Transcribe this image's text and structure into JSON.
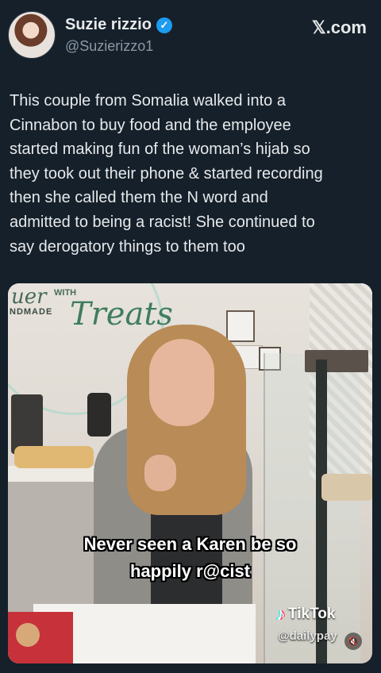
{
  "author": {
    "name": "Suzie rizzio",
    "handle": "@Suzierizzo1",
    "verified_icon": "verified-badge-icon"
  },
  "brand": "𝕏.com",
  "tweet": {
    "text": "This couple from Somalia walked into a\nCinnabon to buy food and the employee\nstarted making fun of the woman’s hijab so\nthey took out their phone & started recording\nthen she called them the N word and\nadmitted to being a racist! She continued to\nsay derogatory things to them too"
  },
  "media": {
    "sign": {
      "word1": "uer",
      "word2": "WITH",
      "word3": "NDMADE",
      "word4": "Treats"
    },
    "caption_line1": "Never seen a Karen be so",
    "caption_line2": "happily r@cist",
    "watermark_label": "TikTok",
    "watermark_user": "@dailypay"
  }
}
